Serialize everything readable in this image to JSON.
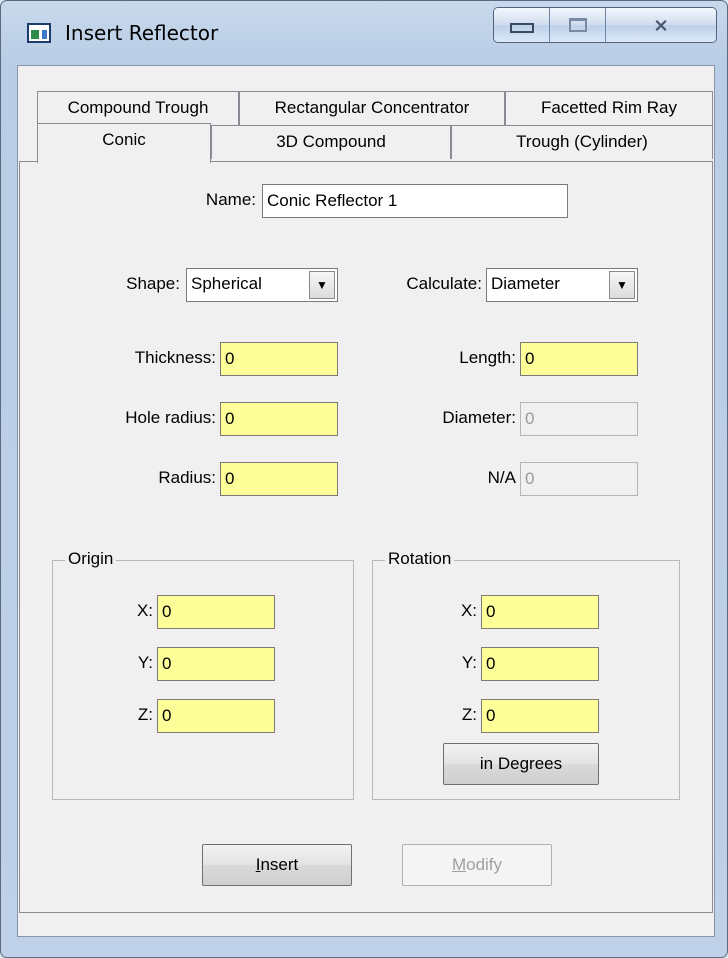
{
  "window": {
    "title": "Insert Reflector",
    "close_glyph": "⨯"
  },
  "tabs_row1": [
    "Compound Trough",
    "Rectangular Concentrator",
    "Facetted Rim Ray"
  ],
  "tabs_row2": [
    "Conic",
    "3D Compound",
    "Trough (Cylinder)"
  ],
  "active_tab": "Conic",
  "form": {
    "name_label": "Name:",
    "name_value": "Conic Reflector 1",
    "shape_label": "Shape:",
    "shape_value": "Spherical",
    "calculate_label": "Calculate:",
    "calculate_value": "Diameter",
    "thickness_label": "Thickness:",
    "thickness_value": "0",
    "length_label": "Length:",
    "length_value": "0",
    "hole_radius_label": "Hole radius:",
    "hole_radius_value": "0",
    "diameter_label": "Diameter:",
    "diameter_value": "0",
    "radius_label": "Radius:",
    "radius_value": "0",
    "na_label": "N/A",
    "na_value": "0"
  },
  "origin": {
    "title": "Origin",
    "x_label": "X:",
    "x_value": "0",
    "y_label": "Y:",
    "y_value": "0",
    "z_label": "Z:",
    "z_value": "0"
  },
  "rotation": {
    "title": "Rotation",
    "x_label": "X:",
    "x_value": "0",
    "y_label": "Y:",
    "y_value": "0",
    "z_label": "Z:",
    "z_value": "0",
    "units_button": "in Degrees"
  },
  "buttons": {
    "insert_mnemonic": "I",
    "insert_rest": "nsert",
    "modify_mnemonic": "M",
    "modify_rest": "odify"
  },
  "colors": {
    "required_field": "#ffff99",
    "titlebar": "#c9d9ec"
  }
}
